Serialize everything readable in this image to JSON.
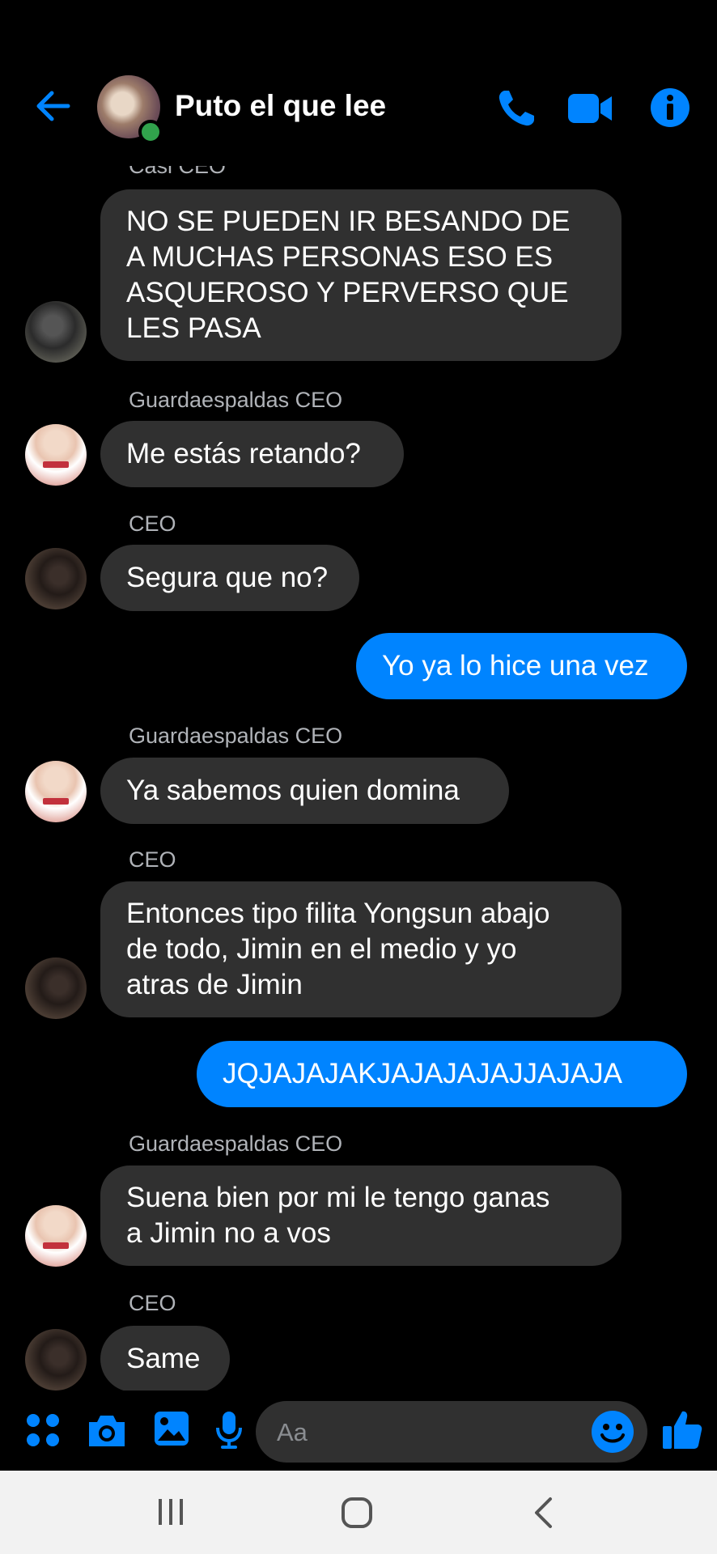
{
  "header": {
    "title": "Puto el que lee",
    "icons": [
      "back-arrow-icon",
      "phone-icon",
      "video-camera-icon",
      "info-icon"
    ]
  },
  "messages": [
    {
      "sender": "Casi CEO",
      "text": "NO SE PUEDEN IR BESANDO DE\nA MUCHAS PERSONAS ESO ES\nASQUEROSO Y PERVERSO QUE\nLES PASA",
      "direction": "incoming"
    },
    {
      "sender": "Guardaespaldas CEO",
      "text": "Me estás retando?",
      "direction": "incoming"
    },
    {
      "sender": "CEO",
      "text": "Segura que no?",
      "direction": "incoming"
    },
    {
      "text": "Yo ya lo hice una vez",
      "direction": "outgoing"
    },
    {
      "sender": "Guardaespaldas CEO",
      "text": "Ya sabemos quien domina",
      "direction": "incoming"
    },
    {
      "sender": "CEO",
      "text": "Entonces tipo filita Yongsun abajo\nde todo, Jimin en el medio y yo\natras de Jimin",
      "direction": "incoming"
    },
    {
      "text": "JQJAJAJAKJAJAJAJAJJAJAJA",
      "direction": "outgoing"
    },
    {
      "sender": "Guardaespaldas CEO",
      "text": "Suena bien por mi le tengo ganas\na Jimin no a vos",
      "direction": "incoming"
    },
    {
      "sender": "CEO",
      "text": "Same",
      "direction": "incoming"
    }
  ],
  "composer": {
    "placeholder": "Aa",
    "icons": [
      "apps-grid-icon",
      "camera-icon",
      "gallery-icon",
      "microphone-icon",
      "emoji-icon",
      "thumbs-up-icon"
    ]
  },
  "navbar": {
    "icons": [
      "recent-apps-icon",
      "home-icon",
      "back-icon"
    ]
  },
  "colors": {
    "accent": "#0084ff",
    "incoming_bubble": "#303030",
    "background": "#000000",
    "online": "#31a24c"
  }
}
